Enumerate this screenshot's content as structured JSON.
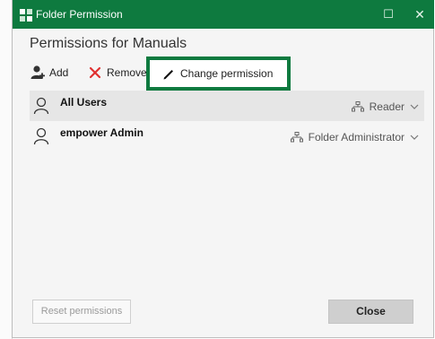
{
  "window": {
    "title": "Folder Permission",
    "maximize_glyph": "☐",
    "close_glyph": "✕"
  },
  "heading": "Permissions for Manuals",
  "toolbar": {
    "add_label": "Add",
    "remove_label": "Remove",
    "change_label": "Change permission"
  },
  "users": [
    {
      "name": "All Users",
      "role": "Reader",
      "selected": true
    },
    {
      "name": "empower Admin",
      "role": "Folder Administrator",
      "selected": false
    }
  ],
  "footer": {
    "reset_label": "Reset permissions",
    "close_label": "Close"
  },
  "colors": {
    "titlebar": "#0e7a3f",
    "highlight_border": "#0e7a3f",
    "remove_icon": "#e03030",
    "selected_row": "#e6e6e6"
  },
  "icons": {
    "app": "folder-permission-icon",
    "add": "add-user-icon",
    "remove": "x-icon",
    "change": "pencil-icon",
    "user": "user-icon",
    "role": "network-icon",
    "dropdown": "chevron-down-icon"
  }
}
